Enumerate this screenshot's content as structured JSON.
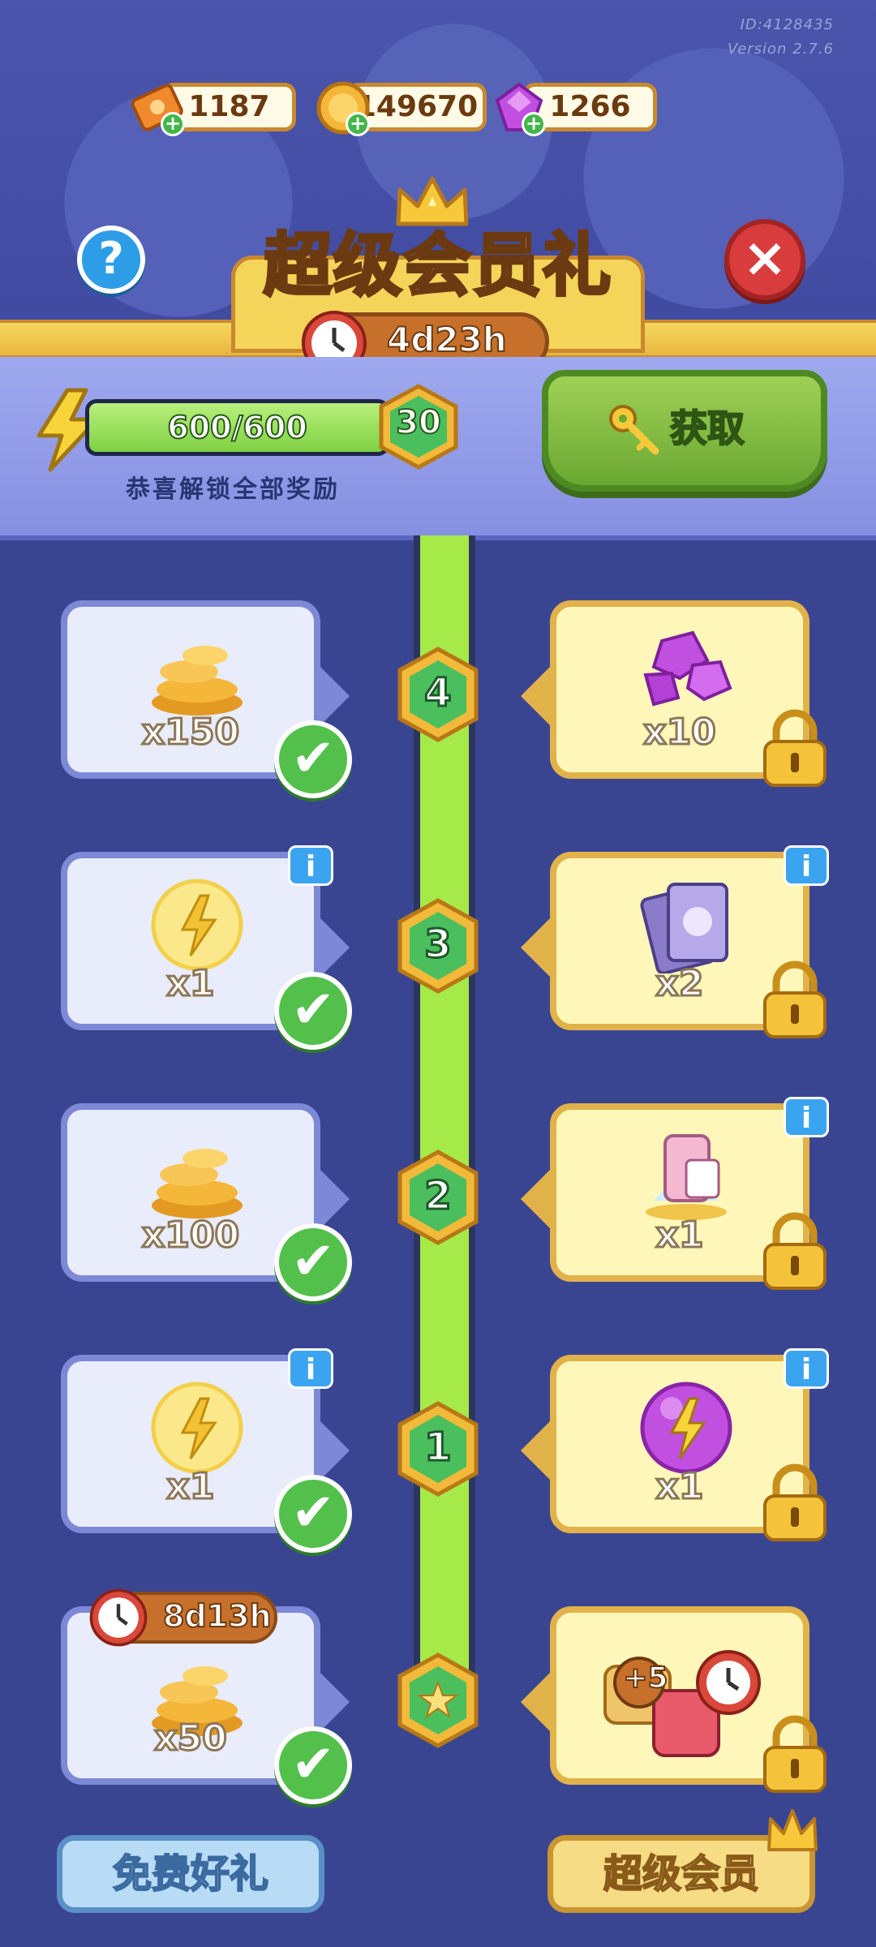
{
  "meta": {
    "id": "ID:4128435",
    "version": "Version 2.7.6"
  },
  "resources": {
    "tickets": "1187",
    "coins": "149670",
    "gems": "1266"
  },
  "header": {
    "title": "超级会员礼",
    "timer": "4d23h"
  },
  "progress": {
    "label": "600/600",
    "fraction": 1.0,
    "level": "30",
    "caption": "恭喜解锁全部奖励",
    "get_label": "获取"
  },
  "tiers": [
    {
      "level": "4",
      "free_qty": "x150",
      "vip_qty": "x10"
    },
    {
      "level": "3",
      "free_qty": "x1",
      "vip_qty": "x2"
    },
    {
      "level": "2",
      "free_qty": "x100",
      "vip_qty": "x1"
    },
    {
      "level": "1",
      "free_qty": "x1",
      "vip_qty": "x1"
    }
  ],
  "base_tier": {
    "free_qty": "x50",
    "free_timer": "8d13h",
    "vip_badge": "+5"
  },
  "info_glyph": "i",
  "check_glyph": "✔",
  "tabs": {
    "free": "免费好礼",
    "vip": "超级会员"
  },
  "colors": {
    "background": "#3a4592",
    "accent_green": "#52c04b",
    "gold": "#e2b24a",
    "close_red": "#d83c3c"
  }
}
